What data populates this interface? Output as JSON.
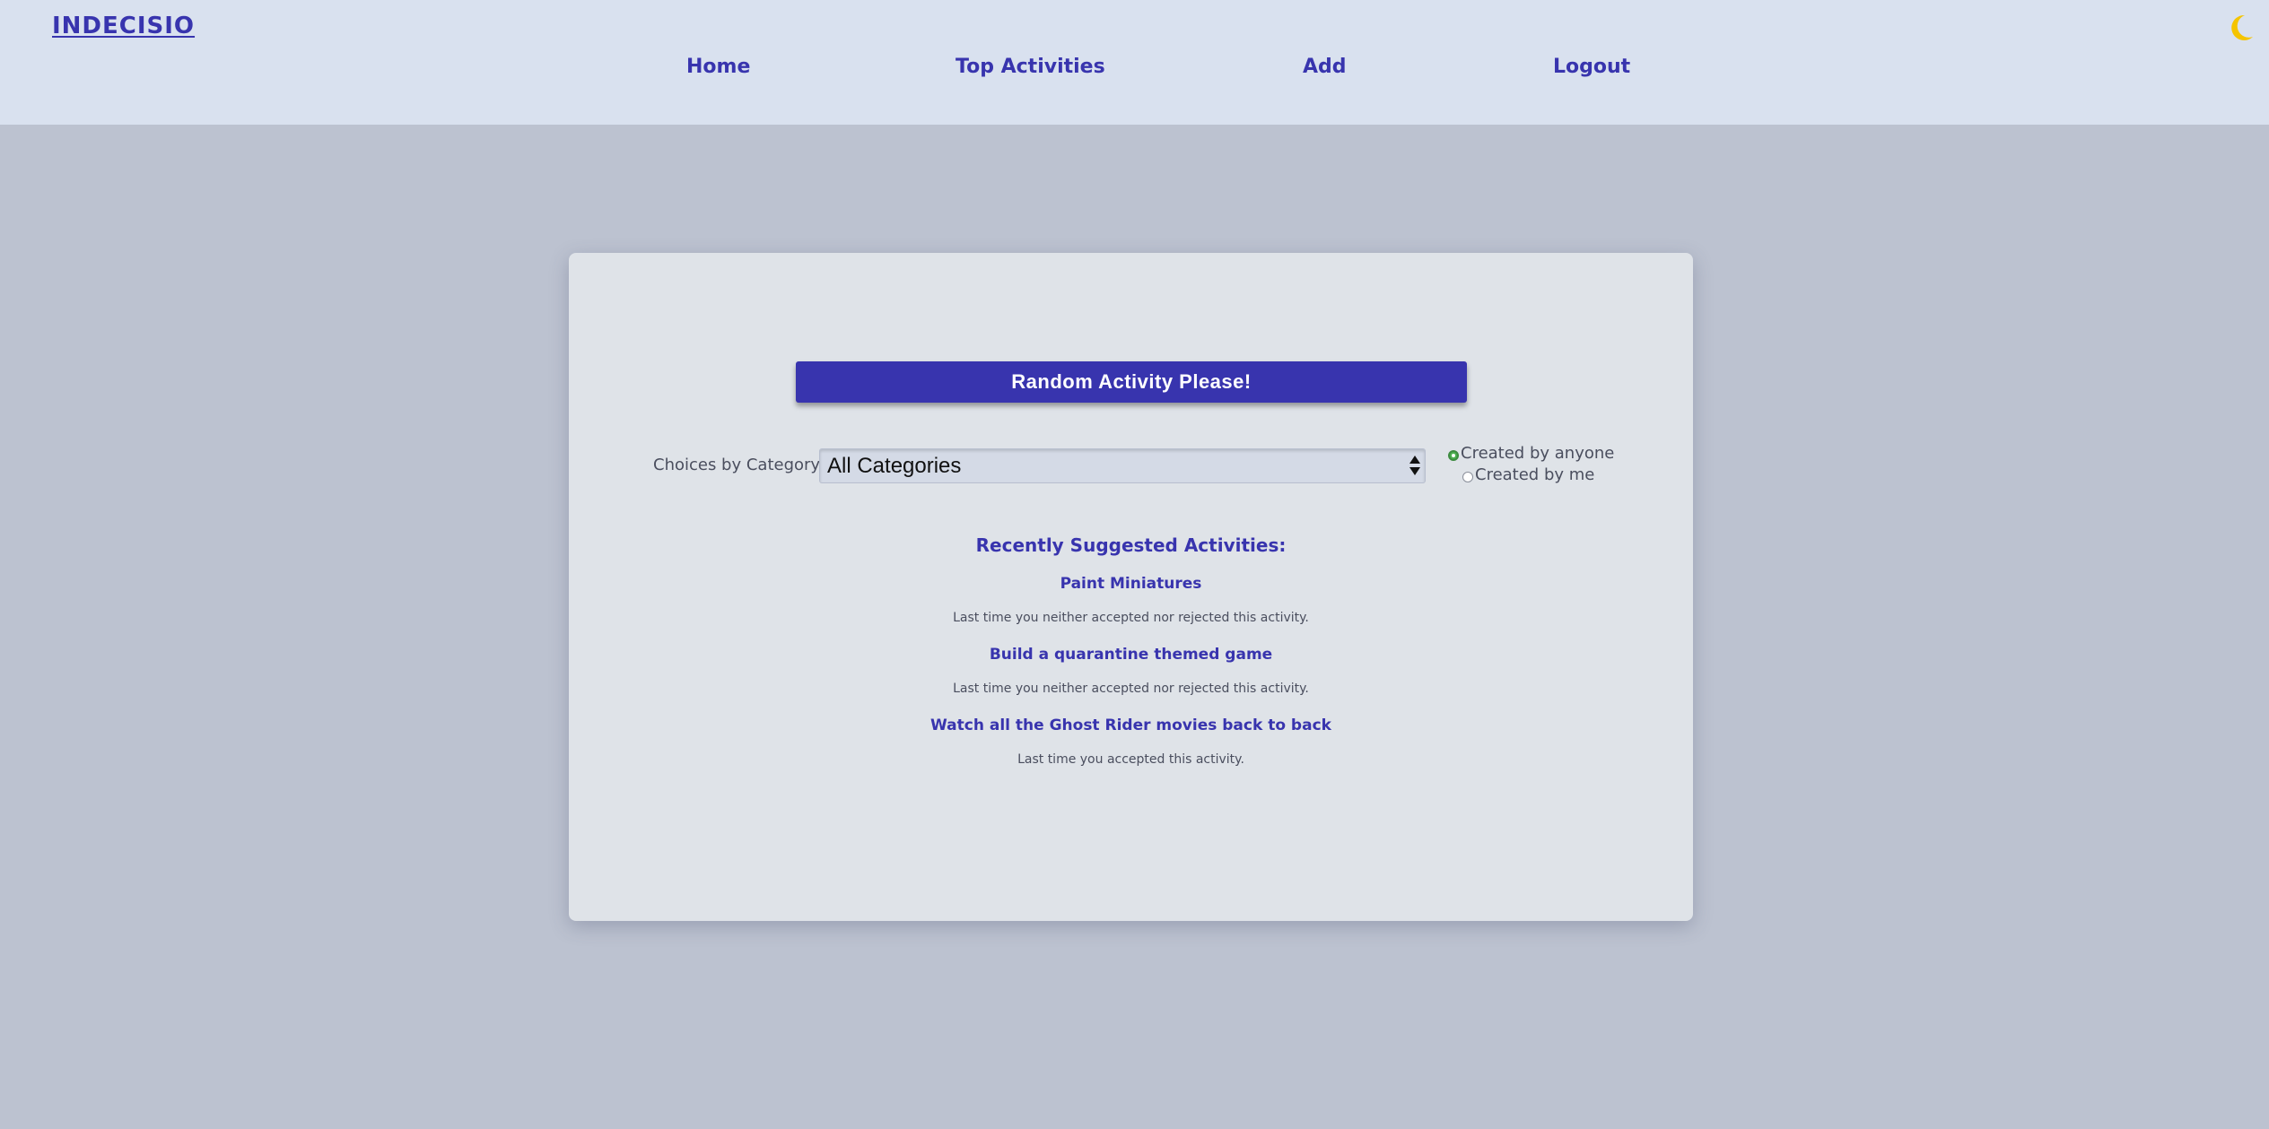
{
  "header": {
    "logo": "INDECISIO",
    "nav": {
      "home": "Home",
      "top_activities": "Top Activities",
      "add": "Add",
      "logout": "Logout"
    },
    "theme_toggle_icon": "moon-icon"
  },
  "main": {
    "random_button_label": "Random Activity Please!",
    "category": {
      "label": "Choices by Category:",
      "selected": "All Categories"
    },
    "filters": {
      "anyone_label": "Created by anyone",
      "me_label": "Created by me",
      "selected": "anyone"
    },
    "recent": {
      "heading": "Recently Suggested Activities:",
      "items": [
        {
          "title": "Paint Miniatures",
          "note": "Last time you neither accepted nor rejected this activity."
        },
        {
          "title": "Build a quarantine themed game",
          "note": "Last time you neither accepted nor rejected this activity."
        },
        {
          "title": "Watch all the Ghost Rider movies back to back",
          "note": "Last time you accepted this activity."
        }
      ]
    }
  },
  "colors": {
    "brand": "#3834ae",
    "header_bg": "#d9e1ef",
    "page_bg": "#bcc2d0",
    "card_bg": "#dfe3e8",
    "radio_checked": "#4caf50",
    "moon": "#f5c400"
  }
}
